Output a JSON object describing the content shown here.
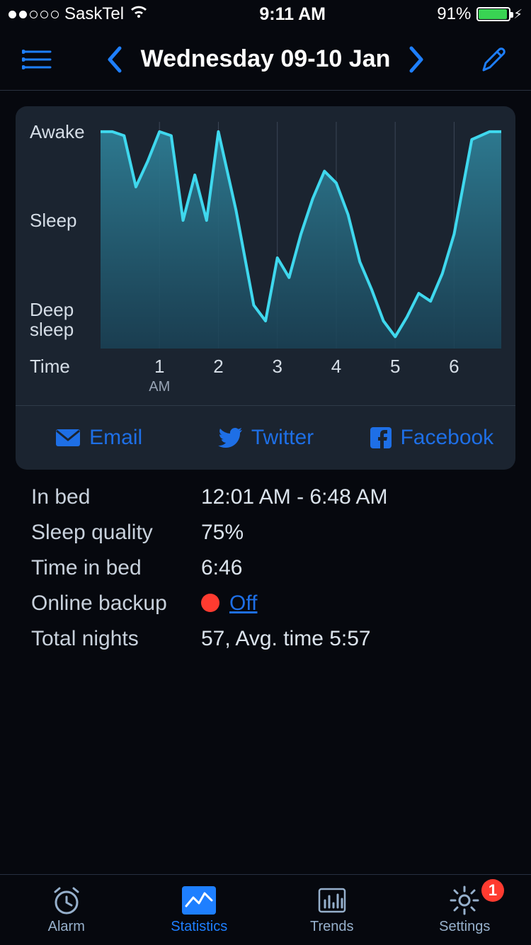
{
  "status": {
    "carrier": "SaskTel",
    "time": "9:11 AM",
    "battery_pct": "91%",
    "battery_fill": 91
  },
  "nav": {
    "title": "Wednesday 09-10 Jan"
  },
  "chart_data": {
    "type": "area",
    "title": "",
    "xlabel": "Time",
    "ylabel": "",
    "y_categories": [
      "Awake",
      "Sleep",
      "Deep sleep"
    ],
    "x_ticks": [
      {
        "label": "1",
        "sub": "AM"
      },
      {
        "label": "2",
        "sub": ""
      },
      {
        "label": "3",
        "sub": ""
      },
      {
        "label": "4",
        "sub": ""
      },
      {
        "label": "5",
        "sub": ""
      },
      {
        "label": "6",
        "sub": ""
      }
    ],
    "x": [
      0.0,
      0.2,
      0.4,
      0.6,
      0.8,
      1.0,
      1.2,
      1.4,
      1.6,
      1.8,
      2.0,
      2.3,
      2.6,
      2.8,
      3.0,
      3.2,
      3.4,
      3.6,
      3.8,
      4.0,
      4.2,
      4.4,
      4.6,
      4.8,
      5.0,
      5.2,
      5.4,
      5.6,
      5.8,
      6.0,
      6.3,
      6.6,
      6.8
    ],
    "series": [
      {
        "name": "sleep-depth",
        "values": [
          1.0,
          1.0,
          0.98,
          0.72,
          0.85,
          1.0,
          0.98,
          0.55,
          0.78,
          0.55,
          1.0,
          0.6,
          0.12,
          0.04,
          0.36,
          0.26,
          0.48,
          0.66,
          0.8,
          0.74,
          0.58,
          0.34,
          0.2,
          0.04,
          -0.04,
          0.06,
          0.18,
          0.14,
          0.28,
          0.48,
          0.96,
          1.0,
          1.0
        ]
      }
    ],
    "ylim": [
      -0.1,
      1.05
    ],
    "y_scale_note": "1.0 = Awake, 0.5 ≈ Sleep, 0.0 ≈ Deep sleep"
  },
  "share": {
    "email": "Email",
    "twitter": "Twitter",
    "facebook": "Facebook"
  },
  "info": {
    "in_bed_label": "In bed",
    "in_bed_value": "12:01 AM - 6:48 AM",
    "quality_label": "Sleep quality",
    "quality_value": "75%",
    "time_label": "Time in bed",
    "time_value": "6:46",
    "backup_label": "Online backup",
    "backup_value": "Off",
    "nights_label": "Total nights",
    "nights_value": "57, Avg. time 5:57"
  },
  "tabs": {
    "alarm": "Alarm",
    "statistics": "Statistics",
    "trends": "Trends",
    "settings": "Settings",
    "badge": "1"
  }
}
